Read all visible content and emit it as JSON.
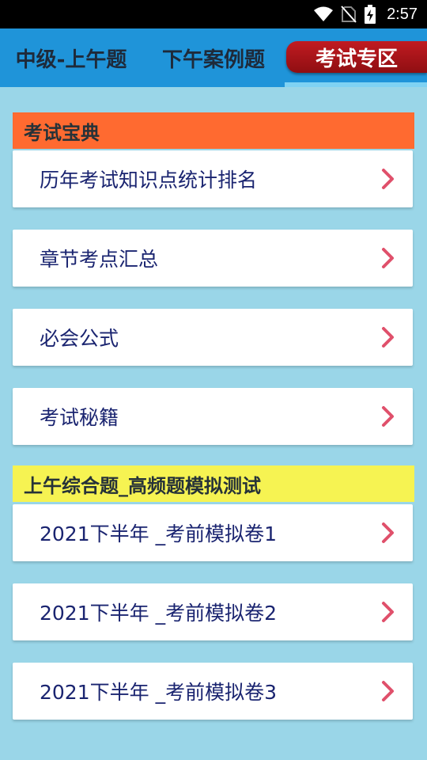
{
  "status_bar": {
    "time": "2:57",
    "icons": [
      "wifi-icon",
      "no-sim-icon",
      "battery-charging-icon"
    ]
  },
  "tabs": [
    {
      "label": "中级-上午题",
      "active": false
    },
    {
      "label": "下午案例题",
      "active": false
    },
    {
      "label": "考试专区",
      "active": true
    }
  ],
  "sections": [
    {
      "title": "考试宝典",
      "color": "#ff6a30",
      "items": [
        {
          "label": "历年考试知识点统计排名"
        },
        {
          "label": "章节考点汇总"
        },
        {
          "label": "必会公式"
        },
        {
          "label": "考试秘籍"
        }
      ]
    },
    {
      "title": "上午综合题_高频题模拟测试",
      "color": "#f6f352",
      "items": [
        {
          "label": "2021下半年 _考前模拟卷1"
        },
        {
          "label": "2021下半年 _考前模拟卷2"
        },
        {
          "label": "2021下半年 _考前模拟卷3"
        }
      ]
    }
  ],
  "colors": {
    "tab_bar": "#1f94d9",
    "active_tab": "#b3161b",
    "background": "#9ad6e8",
    "chevron": "#e0506b",
    "item_text": "#1a2470"
  }
}
